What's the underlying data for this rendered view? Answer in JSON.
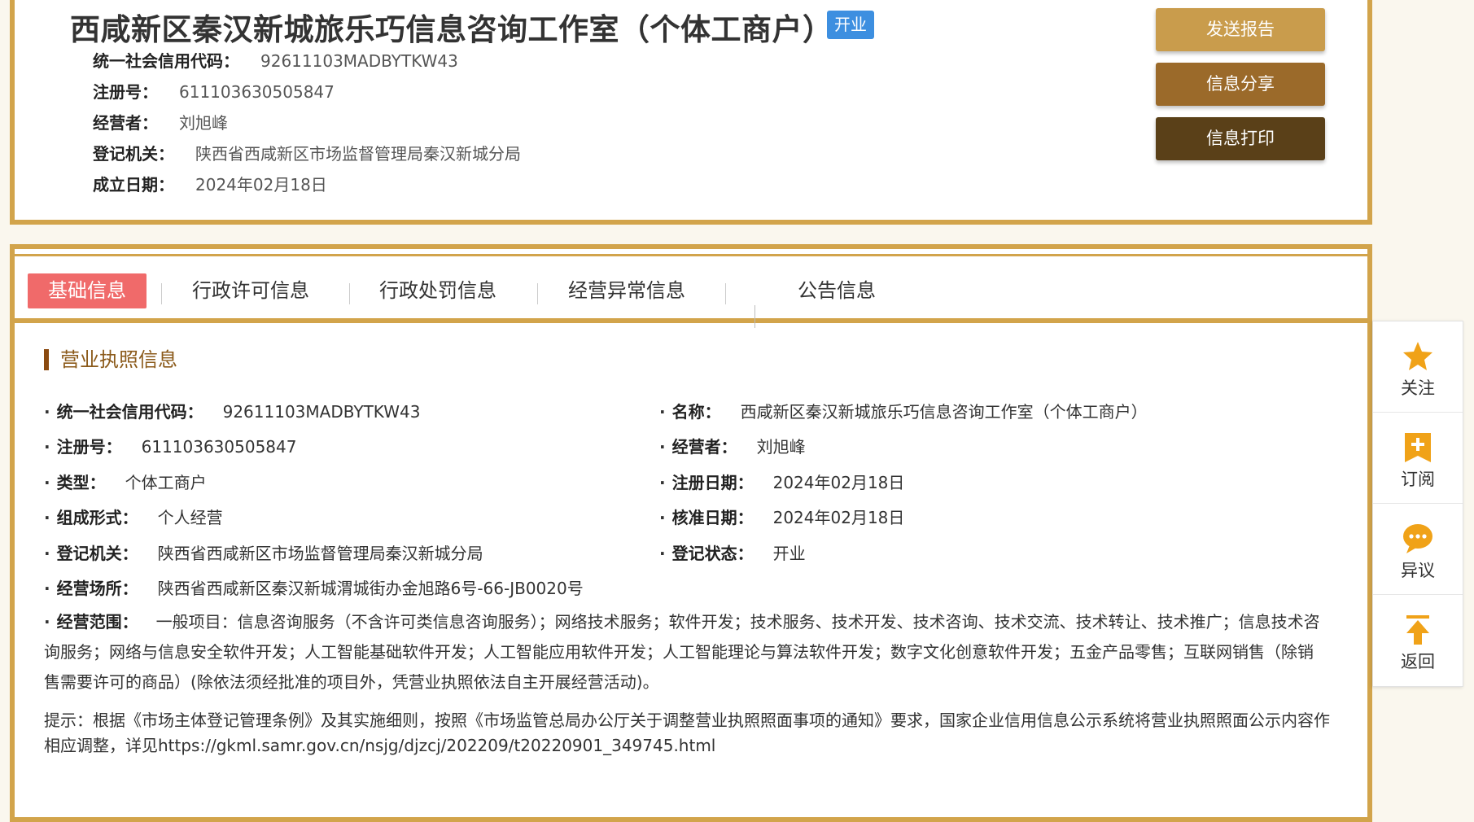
{
  "header": {
    "company_name": "西咸新区秦汉新城旅乐巧信息咨询工作室（个体工商户）",
    "status_badge": "开业",
    "info": [
      {
        "label": "统一社会信用代码：",
        "value": "92611103MADBYTKW43"
      },
      {
        "label": "注册号：",
        "value": "611103630505847"
      },
      {
        "label": "经营者：",
        "value": "刘旭峰"
      },
      {
        "label": "登记机关：",
        "value": "陕西省西咸新区市场监督管理局秦汉新城分局"
      },
      {
        "label": "成立日期：",
        "value": "2024年02月18日"
      }
    ],
    "buttons": {
      "send": "发送报告",
      "share": "信息分享",
      "print": "信息打印"
    },
    "colors": {
      "accent": "#d2a44b",
      "badge": "#3d8fe0",
      "send": "#c99c4c",
      "share": "#9b6a2a",
      "print": "#5a4018"
    }
  },
  "tabs": [
    {
      "label": "基础信息",
      "active": true
    },
    {
      "label": "行政许可信息"
    },
    {
      "label": "行政处罚信息"
    },
    {
      "label": "经营异常信息"
    },
    {
      "label": "公告信息"
    }
  ],
  "section": {
    "title": "营业执照信息",
    "left_fields": [
      {
        "label": "统一社会信用代码：",
        "value": "92611103MADBYTKW43"
      },
      {
        "label": "注册号：",
        "value": "611103630505847"
      },
      {
        "label": "类型：",
        "value": "个体工商户"
      },
      {
        "label": "组成形式：",
        "value": "个人经营"
      },
      {
        "label": "登记机关：",
        "value": "陕西省西咸新区市场监督管理局秦汉新城分局"
      },
      {
        "label": "经营场所：",
        "value": "陕西省西咸新区秦汉新城渭城街办金旭路6号-66-JB0020号"
      }
    ],
    "right_fields": [
      {
        "label": "名称：",
        "value": "西咸新区秦汉新城旅乐巧信息咨询工作室（个体工商户）"
      },
      {
        "label": "经营者：",
        "value": "刘旭峰"
      },
      {
        "label": "注册日期：",
        "value": "2024年02月18日"
      },
      {
        "label": "核准日期：",
        "value": "2024年02月18日"
      },
      {
        "label": "登记状态：",
        "value": "开业"
      }
    ],
    "scope": {
      "label": "经营范围：",
      "value": "一般项目：信息咨询服务（不含许可类信息咨询服务）；网络技术服务；软件开发；技术服务、技术开发、技术咨询、技术交流、技术转让、技术推广；信息技术咨询服务；网络与信息安全软件开发；人工智能基础软件开发；人工智能应用软件开发；人工智能理论与算法软件开发；数字文化创意软件开发；五金产品零售；互联网销售（除销售需要许可的商品）(除依法须经批准的项目外，凭营业执照依法自主开展经营活动)。"
    },
    "hint": "提示：根据《市场主体登记管理条例》及其实施细则，按照《市场监管总局办公厅关于调整营业执照照面事项的通知》要求，国家企业信用信息公示系统将营业执照照面公示内容作相应调整，详见https://gkml.samr.gov.cn/nsjg/djzcj/202209/t20220901_349745.html"
  },
  "float_bar": [
    {
      "label": "关注",
      "icon": "star-icon"
    },
    {
      "label": "订阅",
      "icon": "bookmark-plus-icon"
    },
    {
      "label": "异议",
      "icon": "chat-bubble-icon"
    },
    {
      "label": "返回",
      "icon": "arrow-up-icon"
    }
  ]
}
